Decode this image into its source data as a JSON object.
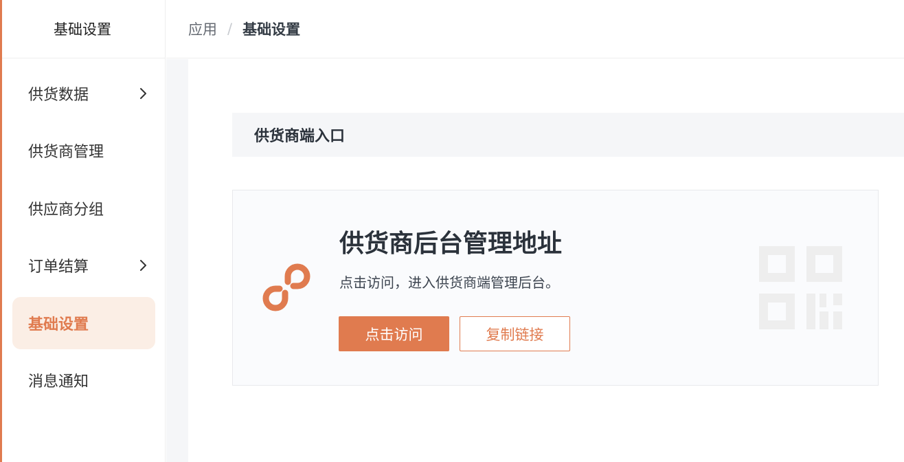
{
  "sidebar": {
    "title": "基础设置",
    "items": [
      {
        "label": "供货数据",
        "has_children": true,
        "active": false
      },
      {
        "label": "供货商管理",
        "has_children": false,
        "active": false
      },
      {
        "label": "供应商分组",
        "has_children": false,
        "active": false
      },
      {
        "label": "订单结算",
        "has_children": true,
        "active": false
      },
      {
        "label": "基础设置",
        "has_children": false,
        "active": true
      },
      {
        "label": "消息通知",
        "has_children": false,
        "active": false
      }
    ]
  },
  "breadcrumb": {
    "parent": "应用",
    "separator": "/",
    "current": "基础设置"
  },
  "section": {
    "title": "供货商端入口"
  },
  "card": {
    "title": "供货商后台管理地址",
    "description": "点击访问，进入供货商端管理后台。",
    "visit_button": "点击访问",
    "copy_button": "复制链接",
    "link_icon": "link-icon",
    "qr_icon": "qr-code-icon"
  },
  "colors": {
    "accent": "#e07b4f",
    "active_bg": "#fbeee5",
    "panel_bg": "#f5f6f8",
    "qr_gray": "#eeeeee"
  }
}
